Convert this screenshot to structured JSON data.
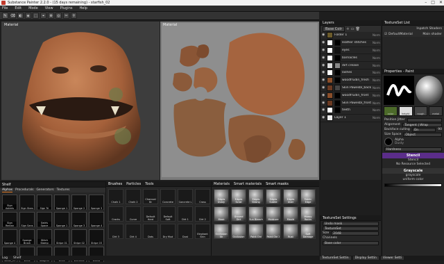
{
  "window": {
    "title": "Substance Painter 2.2.0 - (15 days remaining) - starfish_02",
    "min": "–",
    "max": "□",
    "close": "✕"
  },
  "menu": [
    "File",
    "Edit",
    "Mode",
    "View",
    "Plugins",
    "Help"
  ],
  "toolbar": [
    "✎",
    "⌫",
    "◐",
    "◈",
    "⬚",
    "⌖",
    "⊕",
    "◎",
    "✂",
    "⚲"
  ],
  "viewport3d": {
    "label": "Material"
  },
  "viewport2d": {
    "label": "Material"
  },
  "layers": {
    "title": "Layers",
    "channel_select": "Base Colr",
    "items": [
      {
        "name": "Folder 1",
        "blend": "Norm"
      },
      {
        "name": "leather stitches",
        "blend": "Norm"
      },
      {
        "name": "eyes",
        "blend": "Norm"
      },
      {
        "name": "barnacles",
        "blend": "Norm"
      },
      {
        "name": "dirt crease",
        "blend": "Norm"
      },
      {
        "name": "lashes",
        "blend": "Norm"
      },
      {
        "name": "woodfrudin_fresh",
        "blend": "Norm"
      },
      {
        "name": "Skin Pawesbl_back",
        "blend": "Norm"
      },
      {
        "name": "woodfrudin_front",
        "blend": "Norm"
      },
      {
        "name": "Skin Pawesbl_front",
        "blend": "Norm"
      },
      {
        "name": "teeth",
        "blend": "Norm"
      },
      {
        "name": "Layer 1",
        "blend": "Norm"
      }
    ]
  },
  "textureset_list": {
    "title": "TextureSet List",
    "shader_label": "Inpatch Shaders",
    "set_name": "DefaultMaterial",
    "shader": "Main shader"
  },
  "properties": {
    "title": "Properties - Paint",
    "channels": [
      "color",
      "height",
      "rough",
      "metal",
      "normal"
    ],
    "position_jitter_label": "Position Jitter",
    "alignment_label": "Alignment",
    "alignment_value": "Tangent | Wrap",
    "backface_label": "Backface culling",
    "backface_value": "On",
    "size_space_label": "Size Space",
    "size_space_value": "Object",
    "backface_num": "90",
    "alpha_label": "Alpha",
    "alpha_value": "Dusty",
    "hardness_label": "Hardness",
    "stencil_head": "Stencil",
    "stencil_value": "Stencil",
    "stencil_note": "No Resource Selected",
    "grayscale_head": "Grayscale",
    "grayscale_value": "grayscale",
    "grayscale_sub": "uniform color"
  },
  "shelf": {
    "title": "Shelf",
    "tabs": [
      "Alphas",
      "Procedurals",
      "Generators",
      "Textures"
    ],
    "items": [
      "Sign Asteris",
      "Sign Stars",
      "Sign Tri",
      "Sponge 1",
      "Sponge 2",
      "Sponge 3",
      "Sign Rectan",
      "Sign Sans",
      "Swirls Space",
      "Sponge 1",
      "Sponge 3",
      "Sponge 4",
      "Sponge 4",
      "Sponge Brush",
      "Stitch Stamp",
      "Stripe 01",
      "Stripe 02",
      "Stripe 03",
      "rotate_01",
      "Vertx",
      "Vertx Seagrim",
      "Vertx",
      "Wrinkles",
      "Zebra"
    ]
  },
  "brushes": {
    "tabs": [
      "Brushes",
      "Particles",
      "Tools"
    ],
    "items": [
      "Chalk 1",
      "Chalk 2",
      "Charcoal Br",
      "Concrete",
      "Concrete L",
      "Cross",
      "Cracks",
      "Curve",
      "Default Hard",
      "Default Soft",
      "Dirt 1",
      "Dirt 2",
      "Dirt 3",
      "Dirt 4",
      "Dots",
      "Dry Mud",
      "Dust",
      "Elephant Skin"
    ]
  },
  "materials": {
    "tabs": [
      "Materials",
      "Smart materials",
      "Smart masks"
    ],
    "items": [
      "Edges Dusty",
      "Edges Scrat",
      "Edges Strong",
      "Edges Subtle",
      "Edges Uber",
      "Fabric Edge",
      "Mask",
      "Ground Dirt",
      "Sun Bleach",
      "Moisture",
      "Mould",
      "Mossy Rocks",
      "Occlusion Sh",
      "Occlusion",
      "Paint Old",
      "Paint Old 2",
      "Rust",
      "Soft Damage"
    ]
  },
  "textureset_settings": {
    "title": "TextureSet Settings",
    "set_name": "Undo mask",
    "uv": "TextureSet",
    "size_label": "Size",
    "size_value": "2048",
    "channels_label": "Channels",
    "channel": "Base color"
  },
  "status": {
    "log": "Log",
    "shelf": "Shelf",
    "tabs": [
      "TextureSet Settin",
      "Display Settin",
      "Viewer Setti"
    ]
  }
}
